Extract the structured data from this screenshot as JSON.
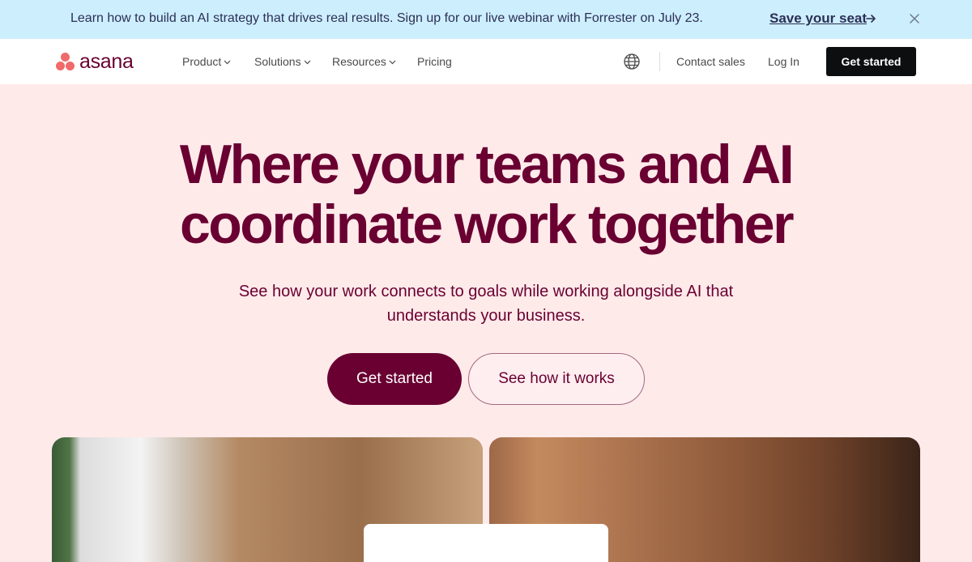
{
  "banner": {
    "text": "Learn how to build an AI strategy that drives real results. Sign up for our live webinar with Forrester on July 23.",
    "link_label": "Save your seat",
    "arrow_icon": "arrow-right-icon",
    "close_icon": "close-icon"
  },
  "nav": {
    "logo_text": "asana",
    "items": [
      {
        "label": "Product",
        "has_dropdown": true
      },
      {
        "label": "Solutions",
        "has_dropdown": true
      },
      {
        "label": "Resources",
        "has_dropdown": true
      },
      {
        "label": "Pricing",
        "has_dropdown": false
      }
    ],
    "globe_icon": "globe-icon",
    "contact_label": "Contact sales",
    "login_label": "Log In",
    "cta_label": "Get started"
  },
  "hero": {
    "title_line1": "Where your teams and AI",
    "title_line2": "coordinate work together",
    "subtitle_line1": "See how your work connects to goals while working alongside AI that",
    "subtitle_line2": "understands your business.",
    "primary_label": "Get started",
    "secondary_label": "See how it works"
  },
  "colors": {
    "brand": "#690031",
    "banner_bg": "#cdeefd",
    "page_bg": "#ffeaea",
    "logo_dots": "#f06a6a"
  }
}
